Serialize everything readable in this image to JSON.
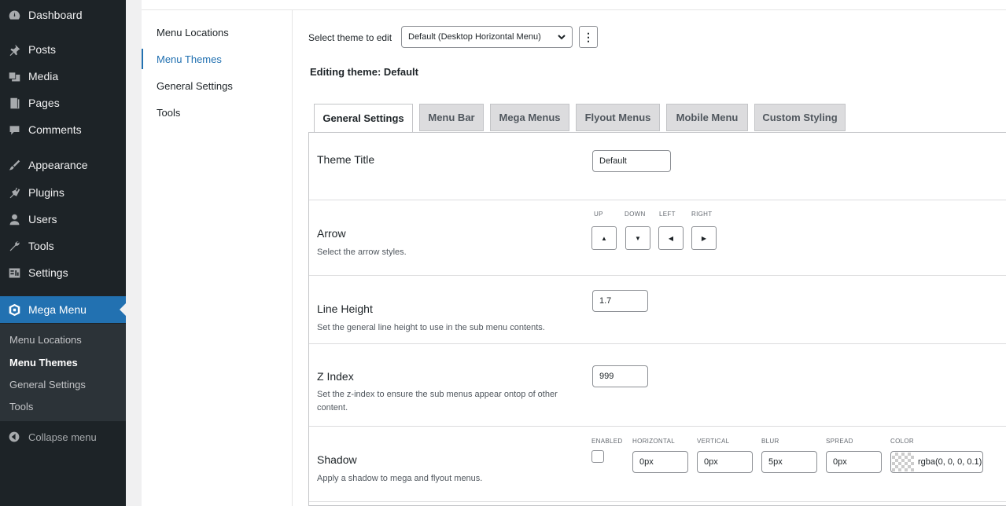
{
  "sidebar": {
    "items": [
      {
        "label": "Dashboard",
        "icon": "dashboard-icon"
      },
      {
        "label": "Posts",
        "icon": "pin-icon"
      },
      {
        "label": "Media",
        "icon": "media-icon"
      },
      {
        "label": "Pages",
        "icon": "pages-icon"
      },
      {
        "label": "Comments",
        "icon": "comment-icon"
      },
      {
        "label": "Appearance",
        "icon": "brush-icon"
      },
      {
        "label": "Plugins",
        "icon": "plugin-icon"
      },
      {
        "label": "Users",
        "icon": "user-icon"
      },
      {
        "label": "Tools",
        "icon": "wrench-icon"
      },
      {
        "label": "Settings",
        "icon": "settings-icon"
      },
      {
        "label": "Mega Menu",
        "icon": "mega-menu-icon"
      }
    ],
    "submenu": [
      "Menu Locations",
      "Menu Themes",
      "General Settings",
      "Tools"
    ],
    "collapse_label": "Collapse menu"
  },
  "left_nav": [
    "Menu Locations",
    "Menu Themes",
    "General Settings",
    "Tools"
  ],
  "theme_select": {
    "label": "Select theme to edit",
    "value": "Default (Desktop Horizontal Menu)",
    "more": "⋮"
  },
  "editing_title": "Editing theme: Default",
  "tabs": [
    "General Settings",
    "Menu Bar",
    "Mega Menus",
    "Flyout Menus",
    "Mobile Menu",
    "Custom Styling"
  ],
  "settings": {
    "theme_title": {
      "label": "Theme Title",
      "value": "Default"
    },
    "arrow": {
      "label": "Arrow",
      "desc": "Select the arrow styles.",
      "directions": [
        "UP",
        "DOWN",
        "LEFT",
        "RIGHT"
      ],
      "glyphs": [
        "▲",
        "▼",
        "◀",
        "▶"
      ]
    },
    "line_height": {
      "label": "Line Height",
      "desc": "Set the general line height to use in the sub menu contents.",
      "value": "1.7"
    },
    "z_index": {
      "label": "Z Index",
      "desc": "Set the z-index to ensure the sub menus appear ontop of other content.",
      "value": "999"
    },
    "shadow": {
      "label": "Shadow",
      "desc": "Apply a shadow to mega and flyout menus.",
      "enabled_label": "ENABLED",
      "enabled": false,
      "fields": [
        {
          "label": "HORIZONTAL",
          "value": "0px"
        },
        {
          "label": "VERTICAL",
          "value": "0px"
        },
        {
          "label": "BLUR",
          "value": "5px"
        },
        {
          "label": "SPREAD",
          "value": "0px"
        }
      ],
      "color_label": "COLOR",
      "color_value": "rgba(0, 0, 0, 0.1)"
    }
  },
  "colors": {
    "sidebar_bg": "#1d2327",
    "accent": "#2271b1",
    "submenu_bg": "#2c3338"
  }
}
